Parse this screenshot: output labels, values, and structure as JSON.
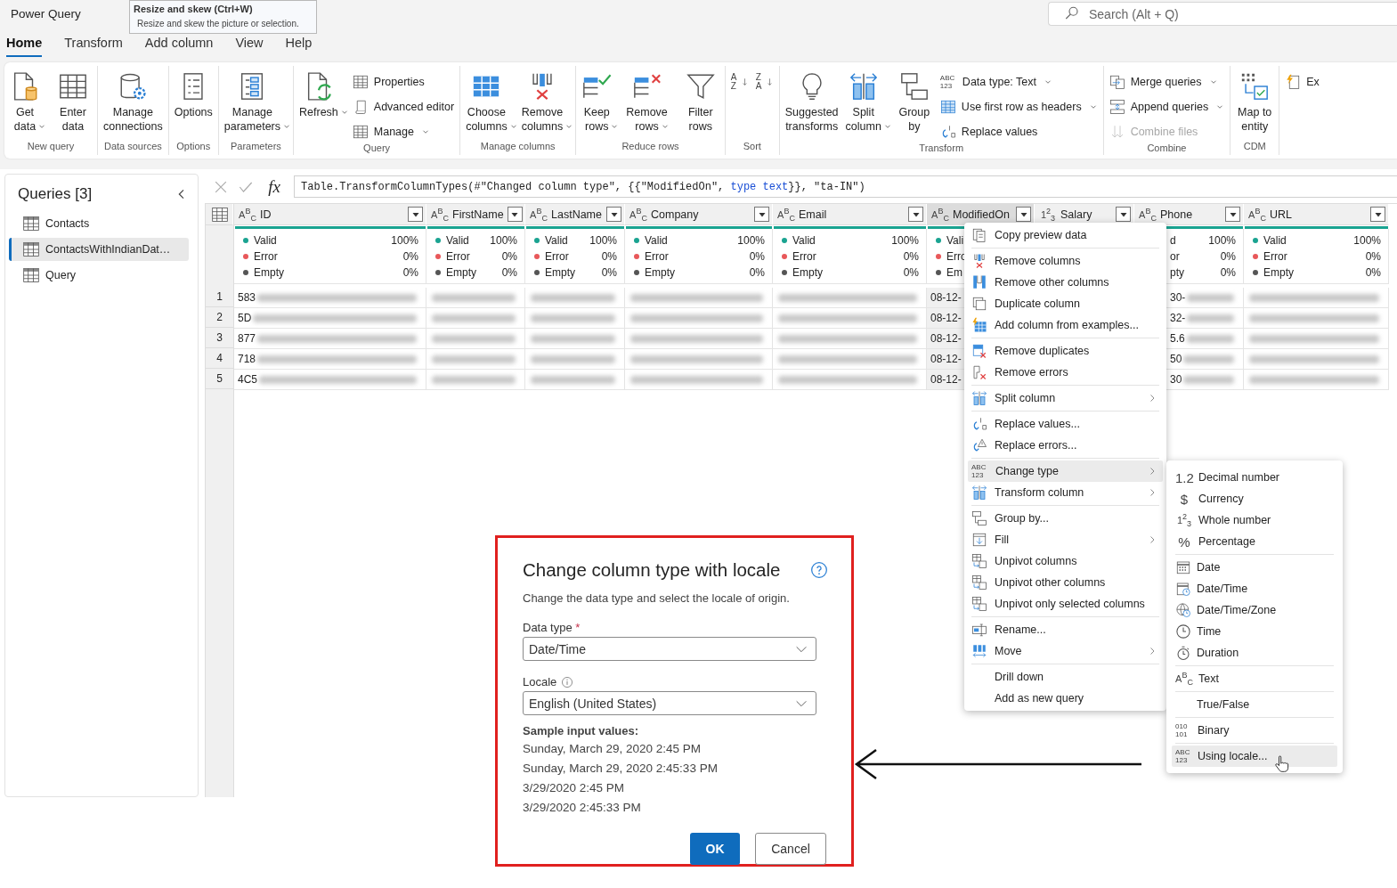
{
  "app": {
    "title": "Power Query",
    "search": {
      "placeholder": "Search (Alt + Q)"
    }
  },
  "tooltip": {
    "title": "Resize and skew (Ctrl+W)",
    "text": "Resize and skew the picture or selection."
  },
  "tabs": [
    {
      "label": "Home",
      "selected": true
    },
    {
      "label": "Transform",
      "selected": false
    },
    {
      "label": "Add column",
      "selected": false
    },
    {
      "label": "View",
      "selected": false
    },
    {
      "label": "Help",
      "selected": false
    }
  ],
  "ribbon": [
    {
      "label": "New query",
      "items": [
        {
          "kind": "large",
          "label": "Get data",
          "dropdown": true,
          "disabled": false
        },
        {
          "kind": "large",
          "label": "Enter data",
          "dropdown": false,
          "disabled": false
        }
      ]
    },
    {
      "label": "Data sources",
      "items": [
        {
          "kind": "large",
          "label": "Manage connections",
          "dropdown": false,
          "disabled": false
        }
      ]
    },
    {
      "label": "Options",
      "items": [
        {
          "kind": "large",
          "label": "Options",
          "dropdown": false,
          "disabled": false
        }
      ]
    },
    {
      "label": "Parameters",
      "items": [
        {
          "kind": "large",
          "label": "Manage parameters",
          "dropdown": true,
          "disabled": false
        }
      ]
    },
    {
      "label": "Query",
      "items": [
        {
          "kind": "large",
          "label": "Refresh",
          "dropdown": true,
          "disabled": false
        },
        {
          "kind": "small",
          "label": "Properties",
          "dropdown": false,
          "disabled": false
        },
        {
          "kind": "small",
          "label": "Advanced editor",
          "dropdown": false,
          "disabled": false
        },
        {
          "kind": "small",
          "label": "Manage",
          "dropdown": true,
          "disabled": false
        }
      ]
    },
    {
      "label": "Manage columns",
      "items": [
        {
          "kind": "large",
          "label": "Choose columns",
          "dropdown": true,
          "disabled": false
        },
        {
          "kind": "large",
          "label": "Remove columns",
          "dropdown": true,
          "disabled": false
        }
      ]
    },
    {
      "label": "Reduce rows",
      "items": [
        {
          "kind": "large",
          "label": "Keep rows",
          "dropdown": true,
          "disabled": false
        },
        {
          "kind": "large",
          "label": "Remove rows",
          "dropdown": true,
          "disabled": false
        },
        {
          "kind": "large",
          "label": "Filter rows",
          "dropdown": false,
          "disabled": false
        }
      ]
    },
    {
      "label": "Sort",
      "items": [
        {
          "kind": "sort",
          "glyph": {
            "text": "A Z",
            "kind": "stacked"
          },
          "disabled": false
        },
        {
          "kind": "sort",
          "glyph": {
            "text": "Z A",
            "kind": "stacked"
          },
          "disabled": false
        }
      ]
    },
    {
      "label": "Transform",
      "items": [
        {
          "kind": "large",
          "label": "Suggested transforms",
          "dropdown": false,
          "disabled": false
        },
        {
          "kind": "large",
          "label": "Split column",
          "dropdown": true,
          "disabled": false
        },
        {
          "kind": "large",
          "label": "Group by",
          "dropdown": false,
          "disabled": false
        },
        {
          "kind": "small",
          "label": "Data type: Text",
          "glyph": {
            "text": "ABC 123",
            "kind": "stacked"
          },
          "dropdown": true,
          "disabled": false
        },
        {
          "kind": "small",
          "label": "Use first row as headers",
          "dropdown": true,
          "disabled": false
        },
        {
          "kind": "small",
          "label": "Replace values",
          "dropdown": false,
          "disabled": false
        }
      ]
    },
    {
      "label": "Combine",
      "items": [
        {
          "kind": "small",
          "label": "Merge queries",
          "dropdown": true,
          "disabled": false
        },
        {
          "kind": "small",
          "label": "Append queries",
          "dropdown": true,
          "disabled": false
        },
        {
          "kind": "small",
          "label": "Combine files",
          "dropdown": false,
          "disabled": true
        }
      ]
    },
    {
      "label": "CDM",
      "items": [
        {
          "kind": "large",
          "label": "Map to entity",
          "dropdown": false,
          "disabled": false
        }
      ]
    },
    {
      "items": [
        {
          "kind": "small",
          "label": "Ex",
          "dropdown": false,
          "disabled": false
        }
      ]
    }
  ],
  "queries": {
    "title": "Queries [3]",
    "items": [
      {
        "label": "Contacts",
        "selected": false
      },
      {
        "label": "ContactsWithIndianDat…",
        "selected": true
      },
      {
        "label": "Query",
        "selected": false
      }
    ]
  },
  "formula_bar": {
    "fx": "fx",
    "segments": [
      {
        "text": "Table.TransformColumnTypes(#\"Changed column type\", {{\"ModifiedOn\", ",
        "kind": "code"
      },
      {
        "text": "type text",
        "kind": "keyword"
      },
      {
        "text": "}}, \"ta-IN\")",
        "kind": "code"
      }
    ]
  },
  "table": {
    "row_numbers": [
      "1",
      "2",
      "3",
      "4",
      "5"
    ],
    "columns": [
      {
        "name": "ID",
        "type": {
          "text": "A$^{B}$$_{C}$",
          "kind": "type"
        },
        "selected": false,
        "stats": [
          {
            "label": "Valid",
            "value": "100%",
            "color": "#1aa391"
          },
          {
            "label": "Error",
            "value": "0%",
            "color": "#e8585a"
          },
          {
            "label": "Empty",
            "value": "0%",
            "color": "#555555"
          }
        ],
        "cells": [
          {
            "text": "583",
            "blurred": true
          },
          {
            "text": "5D",
            "blurred": true
          },
          {
            "text": "877",
            "blurred": true
          },
          {
            "text": "718",
            "blurred": true
          },
          {
            "text": "4C5",
            "blurred": true
          }
        ]
      },
      {
        "name": "FirstName",
        "type": {
          "text": "A$^{B}$$_{C}$",
          "kind": "type"
        },
        "selected": false,
        "stats": [
          {
            "label": "Valid",
            "value": "100%",
            "color": "#1aa391"
          },
          {
            "label": "Error",
            "value": "0%",
            "color": "#e8585a"
          },
          {
            "label": "Empty",
            "value": "0%",
            "color": "#555555"
          }
        ],
        "cells": [
          {
            "blurred": true
          },
          {
            "blurred": true
          },
          {
            "blurred": true
          },
          {
            "blurred": true
          },
          {
            "blurred": true
          }
        ]
      },
      {
        "name": "LastName",
        "type": {
          "text": "A$^{B}$$_{C}$",
          "kind": "type"
        },
        "selected": false,
        "stats": [
          {
            "label": "Valid",
            "value": "100%",
            "color": "#1aa391"
          },
          {
            "label": "Error",
            "value": "0%",
            "color": "#e8585a"
          },
          {
            "label": "Empty",
            "value": "0%",
            "color": "#555555"
          }
        ],
        "cells": [
          {
            "blurred": true
          },
          {
            "blurred": true
          },
          {
            "blurred": true
          },
          {
            "blurred": true
          },
          {
            "blurred": true
          }
        ]
      },
      {
        "name": "Company",
        "type": {
          "text": "A$^{B}$$_{C}$",
          "kind": "type"
        },
        "selected": false,
        "stats": [
          {
            "label": "Valid",
            "value": "100%",
            "color": "#1aa391"
          },
          {
            "label": "Error",
            "value": "0%",
            "color": "#e8585a"
          },
          {
            "label": "Empty",
            "value": "0%",
            "color": "#555555"
          }
        ],
        "cells": [
          {
            "blurred": true
          },
          {
            "blurred": true
          },
          {
            "blurred": true
          },
          {
            "blurred": true
          },
          {
            "blurred": true
          }
        ]
      },
      {
        "name": "Email",
        "type": {
          "text": "A$^{B}$$_{C}$",
          "kind": "type"
        },
        "selected": false,
        "stats": [
          {
            "label": "Valid",
            "value": "100%",
            "color": "#1aa391"
          },
          {
            "label": "Error",
            "value": "0%",
            "color": "#e8585a"
          },
          {
            "label": "Empty",
            "value": "0%",
            "color": "#555555"
          }
        ],
        "cells": [
          {
            "blurred": true
          },
          {
            "blurred": true
          },
          {
            "blurred": true
          },
          {
            "blurred": true
          },
          {
            "blurred": true
          }
        ]
      },
      {
        "name": "ModifiedOn",
        "type": {
          "text": "A$^{B}$$_{C}$",
          "kind": "type"
        },
        "selected": true,
        "stats": [
          {
            "label": "Vali",
            "color": "#1aa391"
          },
          {
            "label": "Erro",
            "color": "#e8585a"
          },
          {
            "label": "Em",
            "color": "#555555"
          }
        ],
        "cells": [
          {
            "text": "08-12-",
            "blurred": false
          },
          {
            "text": "08-12-",
            "blurred": false
          },
          {
            "text": "08-12-",
            "blurred": false
          },
          {
            "text": "08-12-",
            "blurred": false
          },
          {
            "text": "08-12-",
            "blurred": false
          }
        ]
      },
      {
        "name": "Salary",
        "type": {
          "text": "1$^{2}$$_{3}$",
          "kind": "type"
        },
        "selected": false
      },
      {
        "name": "Phone",
        "type": {
          "text": "A$^{B}$$_{C}$",
          "kind": "type"
        },
        "selected": false,
        "stats": [
          {
            "label": "d",
            "value": "100%"
          },
          {
            "label": "or",
            "value": "0%"
          },
          {
            "label": "pty",
            "value": "0%"
          }
        ],
        "cells": [
          {
            "text": "30-",
            "blurred": true
          },
          {
            "text": "32-",
            "blurred": true
          },
          {
            "text": "5.6",
            "blurred": true
          },
          {
            "text": "50",
            "blurred": true
          },
          {
            "text": "30",
            "blurred": true
          }
        ]
      },
      {
        "name": "URL",
        "type": {
          "text": "A$^{B}$$_{C}$",
          "kind": "type"
        },
        "selected": false,
        "stats": [
          {
            "label": "Valid",
            "value": "100%",
            "color": "#1aa391"
          },
          {
            "label": "Error",
            "value": "0%",
            "color": "#e8585a"
          },
          {
            "label": "Empty",
            "value": "0%",
            "color": "#555555"
          }
        ],
        "cells": [
          {
            "blurred": true
          },
          {
            "blurred": true
          },
          {
            "blurred": true
          },
          {
            "blurred": true
          },
          {
            "blurred": true
          }
        ]
      }
    ]
  },
  "context_menu": [
    {
      "kind": "item",
      "label": "Copy preview data",
      "submenu": false,
      "selected": false
    },
    {
      "kind": "separator"
    },
    {
      "kind": "item",
      "label": "Remove columns",
      "submenu": false,
      "selected": false
    },
    {
      "kind": "item",
      "label": "Remove other columns",
      "submenu": false,
      "selected": false
    },
    {
      "kind": "item",
      "label": "Duplicate column",
      "submenu": false,
      "selected": false
    },
    {
      "kind": "item",
      "label": "Add column from examples...",
      "submenu": false,
      "selected": false
    },
    {
      "kind": "separator"
    },
    {
      "kind": "item",
      "label": "Remove duplicates",
      "submenu": false,
      "selected": false
    },
    {
      "kind": "item",
      "label": "Remove errors",
      "submenu": false,
      "selected": false
    },
    {
      "kind": "separator"
    },
    {
      "kind": "item",
      "label": "Split column",
      "submenu": true,
      "selected": false
    },
    {
      "kind": "separator"
    },
    {
      "kind": "item",
      "label": "Replace values...",
      "submenu": false,
      "selected": false
    },
    {
      "kind": "item",
      "label": "Replace errors...",
      "submenu": false,
      "selected": false
    },
    {
      "kind": "separator"
    },
    {
      "kind": "item",
      "label": "Change type",
      "glyph": {
        "text": "ABC 123",
        "kind": "stacked"
      },
      "submenu": true,
      "selected": true
    },
    {
      "kind": "item",
      "label": "Transform column",
      "submenu": true,
      "selected": false
    },
    {
      "kind": "separator"
    },
    {
      "kind": "item",
      "label": "Group by...",
      "submenu": false,
      "selected": false
    },
    {
      "kind": "item",
      "label": "Fill",
      "submenu": true,
      "selected": false
    },
    {
      "kind": "item",
      "label": "Unpivot columns",
      "submenu": false,
      "selected": false
    },
    {
      "kind": "item",
      "label": "Unpivot other columns",
      "submenu": false,
      "selected": false
    },
    {
      "kind": "item",
      "label": "Unpivot only selected columns",
      "submenu": false,
      "selected": false
    },
    {
      "kind": "separator"
    },
    {
      "kind": "item",
      "label": "Rename...",
      "submenu": false,
      "selected": false
    },
    {
      "kind": "item",
      "label": "Move",
      "submenu": true,
      "selected": false
    },
    {
      "kind": "separator"
    },
    {
      "kind": "item",
      "label": "Drill down",
      "submenu": false,
      "selected": false
    },
    {
      "kind": "item",
      "label": "Add as new query",
      "submenu": false,
      "selected": false
    }
  ],
  "type_submenu": [
    {
      "kind": "item",
      "label": "Decimal number",
      "glyph": {
        "text": "1.2",
        "kind": "symbol"
      },
      "selected": false
    },
    {
      "kind": "item",
      "label": "Currency",
      "glyph": {
        "text": "$",
        "kind": "symbol"
      },
      "selected": false
    },
    {
      "kind": "item",
      "label": "Whole number",
      "glyph": {
        "text": "1$^{2}$$_{3}$",
        "kind": "type"
      },
      "selected": false
    },
    {
      "kind": "item",
      "label": "Percentage",
      "glyph": {
        "text": "%",
        "kind": "symbol"
      },
      "selected": false
    },
    {
      "kind": "separator"
    },
    {
      "kind": "item",
      "label": "Date",
      "selected": false
    },
    {
      "kind": "item",
      "label": "Date/Time",
      "selected": false
    },
    {
      "kind": "item",
      "label": "Date/Time/Zone",
      "selected": false
    },
    {
      "kind": "item",
      "label": "Time",
      "selected": false
    },
    {
      "kind": "item",
      "label": "Duration",
      "selected": false
    },
    {
      "kind": "separator"
    },
    {
      "kind": "item",
      "label": "Text",
      "glyph": {
        "text": "A$^{B}$$_{C}$",
        "kind": "type"
      },
      "selected": false
    },
    {
      "kind": "separator"
    },
    {
      "kind": "item",
      "label": "True/False",
      "selected": false
    },
    {
      "kind": "separator"
    },
    {
      "kind": "item",
      "label": "Binary",
      "glyph": {
        "text": "010 101",
        "kind": "stacked"
      },
      "selected": false
    },
    {
      "kind": "separator"
    },
    {
      "kind": "item",
      "label": "Using locale...",
      "glyph": {
        "text": "ABC 123",
        "kind": "stacked"
      },
      "selected": true
    }
  ],
  "dialog": {
    "title": "Change column type with locale",
    "description": "Change the data type and select the locale of origin.",
    "fields": [
      {
        "label": "Data type",
        "required_mark": "*",
        "info": false,
        "value": "Date/Time"
      },
      {
        "label": "Locale",
        "info": true,
        "value": "English (United States)"
      }
    ],
    "sample_label": "Sample input values:",
    "samples": [
      "Sunday, March 29, 2020 2:45 PM",
      "Sunday, March 29, 2020 2:45:33 PM",
      "3/29/2020 2:45 PM",
      "3/29/2020 2:45:33 PM"
    ],
    "buttons": [
      {
        "label": "OK",
        "kind": "primary"
      },
      {
        "label": "Cancel",
        "kind": "secondary"
      }
    ]
  }
}
